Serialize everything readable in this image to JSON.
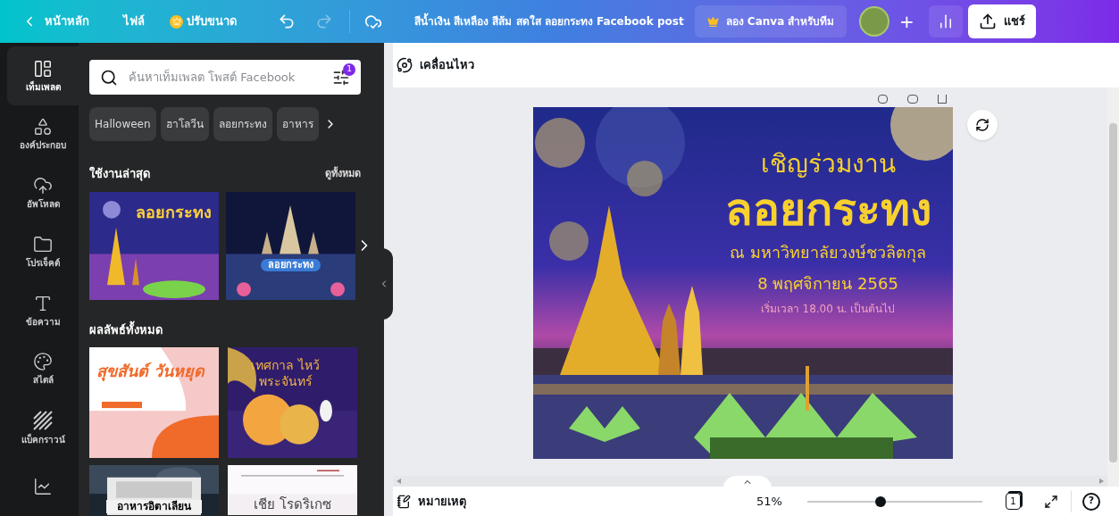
{
  "top_bar": {
    "home": "หน้าหลัก",
    "file_menu": "ไฟล์",
    "resize": "ปรับขนาด",
    "title": "สีน้ำเงิน สีเหลือง สีส้ม สดใส ลอยกระทง Facebook post",
    "team_button": "ลอง Canva สำหรับทีม",
    "add": "+",
    "share": "แชร์"
  },
  "rail": [
    {
      "kind": "templates",
      "label": "เท็มเพลต",
      "selected": true
    },
    {
      "kind": "elements",
      "label": "องค์ประกอบ",
      "selected": false
    },
    {
      "kind": "uploads",
      "label": "อัพโหลด",
      "selected": false
    },
    {
      "kind": "projects",
      "label": "โปรเจ็คต์",
      "selected": false
    },
    {
      "kind": "text",
      "label": "ข้อความ",
      "selected": false
    },
    {
      "kind": "styles",
      "label": "สไตล์",
      "selected": false
    },
    {
      "kind": "background",
      "label": "แบ็คกราวน์",
      "selected": false
    },
    {
      "kind": "charts",
      "selected": false
    }
  ],
  "panel": {
    "search_placeholder": "ค้นหาเท็มเพลต โพสต์ Facebook",
    "filter_badge": "1",
    "chips": [
      "Halloween",
      "ฮาโลวีน",
      "ลอยกระทง",
      "อาหาร"
    ],
    "recent_title": "ใช้งานล่าสุด",
    "see_all": "ดูทั้งหมด",
    "recent": [
      {
        "kind": "loy_night",
        "text": "ลอยกระทง"
      },
      {
        "kind": "temple_river",
        "text": "ลอยกระทง"
      }
    ],
    "results_title": "ผลลัพธ์ทั้งหมด",
    "results": [
      {
        "kind": "holiday",
        "text": "สุขสันต์ วันหยุด"
      },
      {
        "kind": "moon_festival",
        "text": "เทศกาล ไหว้พระจันทร์"
      },
      {
        "kind": "food",
        "text": "อาหารอิตาเลียน"
      },
      {
        "kind": "name_card",
        "text": "เชีย โรดริเกซ"
      }
    ]
  },
  "editor": {
    "toolbar_label": "เคลื่อนไหว",
    "design": {
      "invite": "เชิญร่วมงาน",
      "title": "ลอยกระทง",
      "venue": "ณ มหาวิทยาลัยวงษ์ชวลิตกุล",
      "date": "8 พฤศจิกายน 2565",
      "time": "เริ่มเวลา 18.00 น. เป็นต้นไป"
    }
  },
  "bottom_bar": {
    "notes": "หมายเหตุ",
    "zoom": "51%",
    "level": 0.42,
    "page_count": "1",
    "help": "?"
  }
}
